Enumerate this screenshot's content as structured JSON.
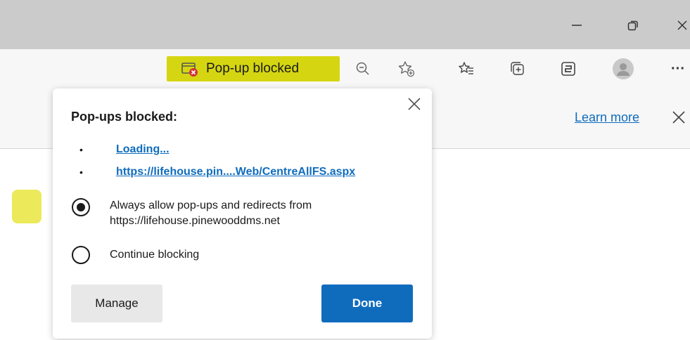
{
  "window": {
    "minimize_icon": "minimize-icon",
    "restore_icon": "restore-icon",
    "close_icon": "close-icon"
  },
  "toolbar": {
    "popup_chip_label": "Pop-up blocked",
    "popup_chip_icon": "popup-blocked-icon",
    "zoom_icon": "zoom-out-icon",
    "favorite_icon": "add-favorite-icon",
    "favorites_icon": "favorites-icon",
    "collections_icon": "collections-icon",
    "screenshot_icon": "web-capture-icon",
    "profile_icon": "profile-avatar",
    "more_label": "···",
    "highlight_color": "#d5d611"
  },
  "infobar": {
    "learn_more": "Learn more"
  },
  "flyout": {
    "title": "Pop-ups blocked:",
    "blocked_items": [
      {
        "label": "Loading..."
      },
      {
        "label": "https://lifehouse.pin....Web/CentreAllFS.aspx"
      }
    ],
    "options": [
      {
        "label_line1": "Always allow pop-ups and redirects from",
        "label_line2": "https://lifehouse.pinewooddms.net",
        "selected": true
      },
      {
        "label_line1": "Continue blocking",
        "selected": false
      }
    ],
    "manage_label": "Manage",
    "done_label": "Done",
    "accent_color": "#0f6cbd"
  }
}
